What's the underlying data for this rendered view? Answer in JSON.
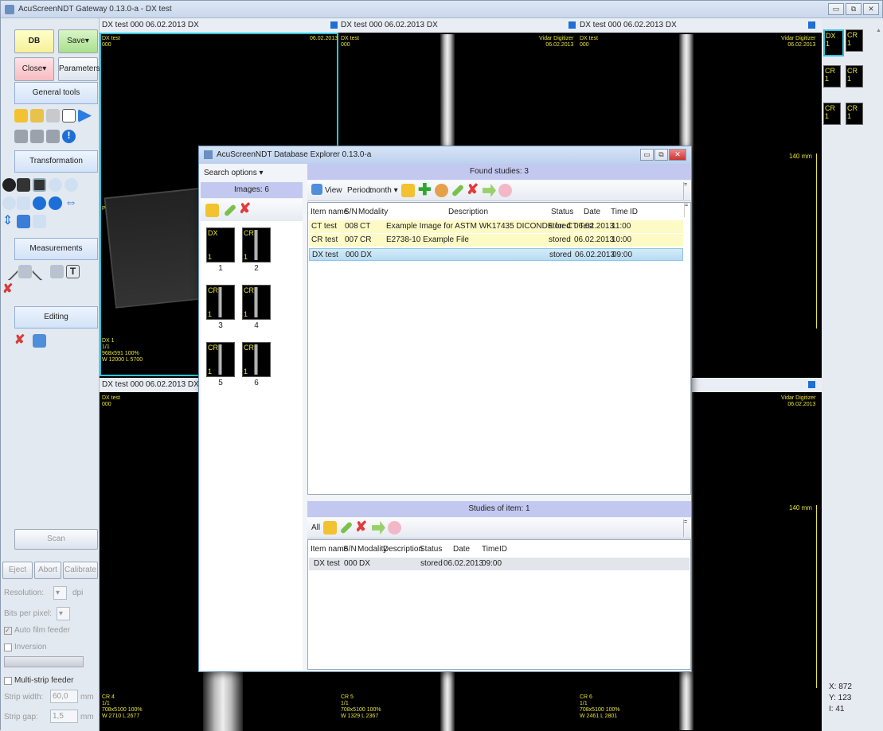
{
  "window": {
    "title": "AcuScreenNDT Gateway 0.13.0-a - DX test",
    "controls": [
      "▭",
      "⧉",
      "✕"
    ]
  },
  "left_panel": {
    "db": "DB",
    "save": "Save▾",
    "close": "Close▾",
    "parameters": "Parameters",
    "general_tools": "General tools",
    "transformation": "Transformation",
    "measurements": "Measurements",
    "editing": "Editing",
    "scan": "Scan",
    "eject": "Eject",
    "abort": "Abort",
    "calibrate": "Calibrate",
    "resolution": "Resolution:",
    "resolution_unit": "dpi",
    "bits_per_pixel": "Bits per pixel:",
    "auto_film_feeder": "Auto film feeder",
    "inversion": "Inversion",
    "multi_strip_feeder": "Multi-strip feeder",
    "strip_width": "Strip width:",
    "strip_width_value": "60,0",
    "strip_width_unit": "mm",
    "strip_gap": "Strip gap:",
    "strip_gap_value": "1,5",
    "strip_gap_unit": "mm"
  },
  "viewer": {
    "headers": [
      "DX test  000  06.02.2013  DX",
      "DX test  000  06.02.2013  DX",
      "DX test  000  06.02.2013  DX",
      "DX test  000  06.02.2013  DX"
    ],
    "overlays": {
      "top_left": "DX test\n000",
      "date": "06.02.2013",
      "digitizer": "Vidar Digitizer\n06.02.2013",
      "ruler_label": "140 mm",
      "p_marker": "P",
      "dx1_info": "DX 1\n1/1\n968x591 100%\nW 12000 L 5700",
      "cr4_info": "CR 4\n1/1\n708x5100 100%\nW 2710 L 2677",
      "cr5_info": "CR 5\n1/1\n708x5100 100%\nW 1329 L 2367",
      "cr6_info": "CR 6\n1/1\n708x5100 100%\nW 2461 L 2801"
    }
  },
  "thumbnails": [
    {
      "label": "DX",
      "n": "1"
    },
    {
      "label": "CR",
      "n": "1"
    },
    {
      "label": "CR",
      "n": "1"
    },
    {
      "label": "CR",
      "n": "1"
    },
    {
      "label": "CR",
      "n": "1"
    },
    {
      "label": "CR",
      "n": "1"
    }
  ],
  "coords": {
    "x": "X: 872",
    "y": "Y: 123",
    "i": "I: 41"
  },
  "dialog": {
    "title": "AcuScreenNDT Database Explorer 0.13.0-a",
    "search_options": "Search options ▾",
    "images_header": "Images: 6",
    "images": [
      {
        "mod": "DX",
        "n": "1",
        "idx": "1"
      },
      {
        "mod": "CR",
        "n": "1",
        "idx": "2"
      },
      {
        "mod": "CR",
        "n": "1",
        "idx": "3"
      },
      {
        "mod": "CR",
        "n": "1",
        "idx": "4"
      },
      {
        "mod": "CR",
        "n": "1",
        "idx": "5"
      },
      {
        "mod": "CR",
        "n": "1",
        "idx": "6"
      }
    ],
    "found_header": "Found studies: 3",
    "view": "View",
    "period_label": "Period:",
    "period_value": "month ▾",
    "columns": [
      "Item name",
      "S/N",
      "Modality",
      "Description",
      "Status",
      "Date",
      "Time",
      "ID"
    ],
    "rows": [
      {
        "name": "CT test",
        "sn": "008",
        "mod": "CT",
        "desc": "Example Image for ASTM WK17435 DICONDE for CT Test",
        "status": "stored",
        "date": "06.02.2013",
        "time": "11:00"
      },
      {
        "name": "CR test",
        "sn": "007",
        "mod": "CR",
        "desc": "E2738-10 Example File",
        "status": "stored",
        "date": "06.02.2013",
        "time": "10:00"
      },
      {
        "name": "DX test",
        "sn": "000",
        "mod": "DX",
        "desc": "",
        "status": "stored",
        "date": "06.02.2013",
        "time": "09:00"
      }
    ],
    "studies_header": "Studies of item: 1",
    "all": "All",
    "columns2": [
      "Item name",
      "S/N",
      "Modality",
      "Description",
      "Status",
      "Date",
      "Time",
      "ID"
    ],
    "rows2": [
      {
        "name": "DX test",
        "sn": "000",
        "mod": "DX",
        "desc": "",
        "status": "stored",
        "date": "06.02.2013",
        "time": "09:00"
      }
    ]
  }
}
